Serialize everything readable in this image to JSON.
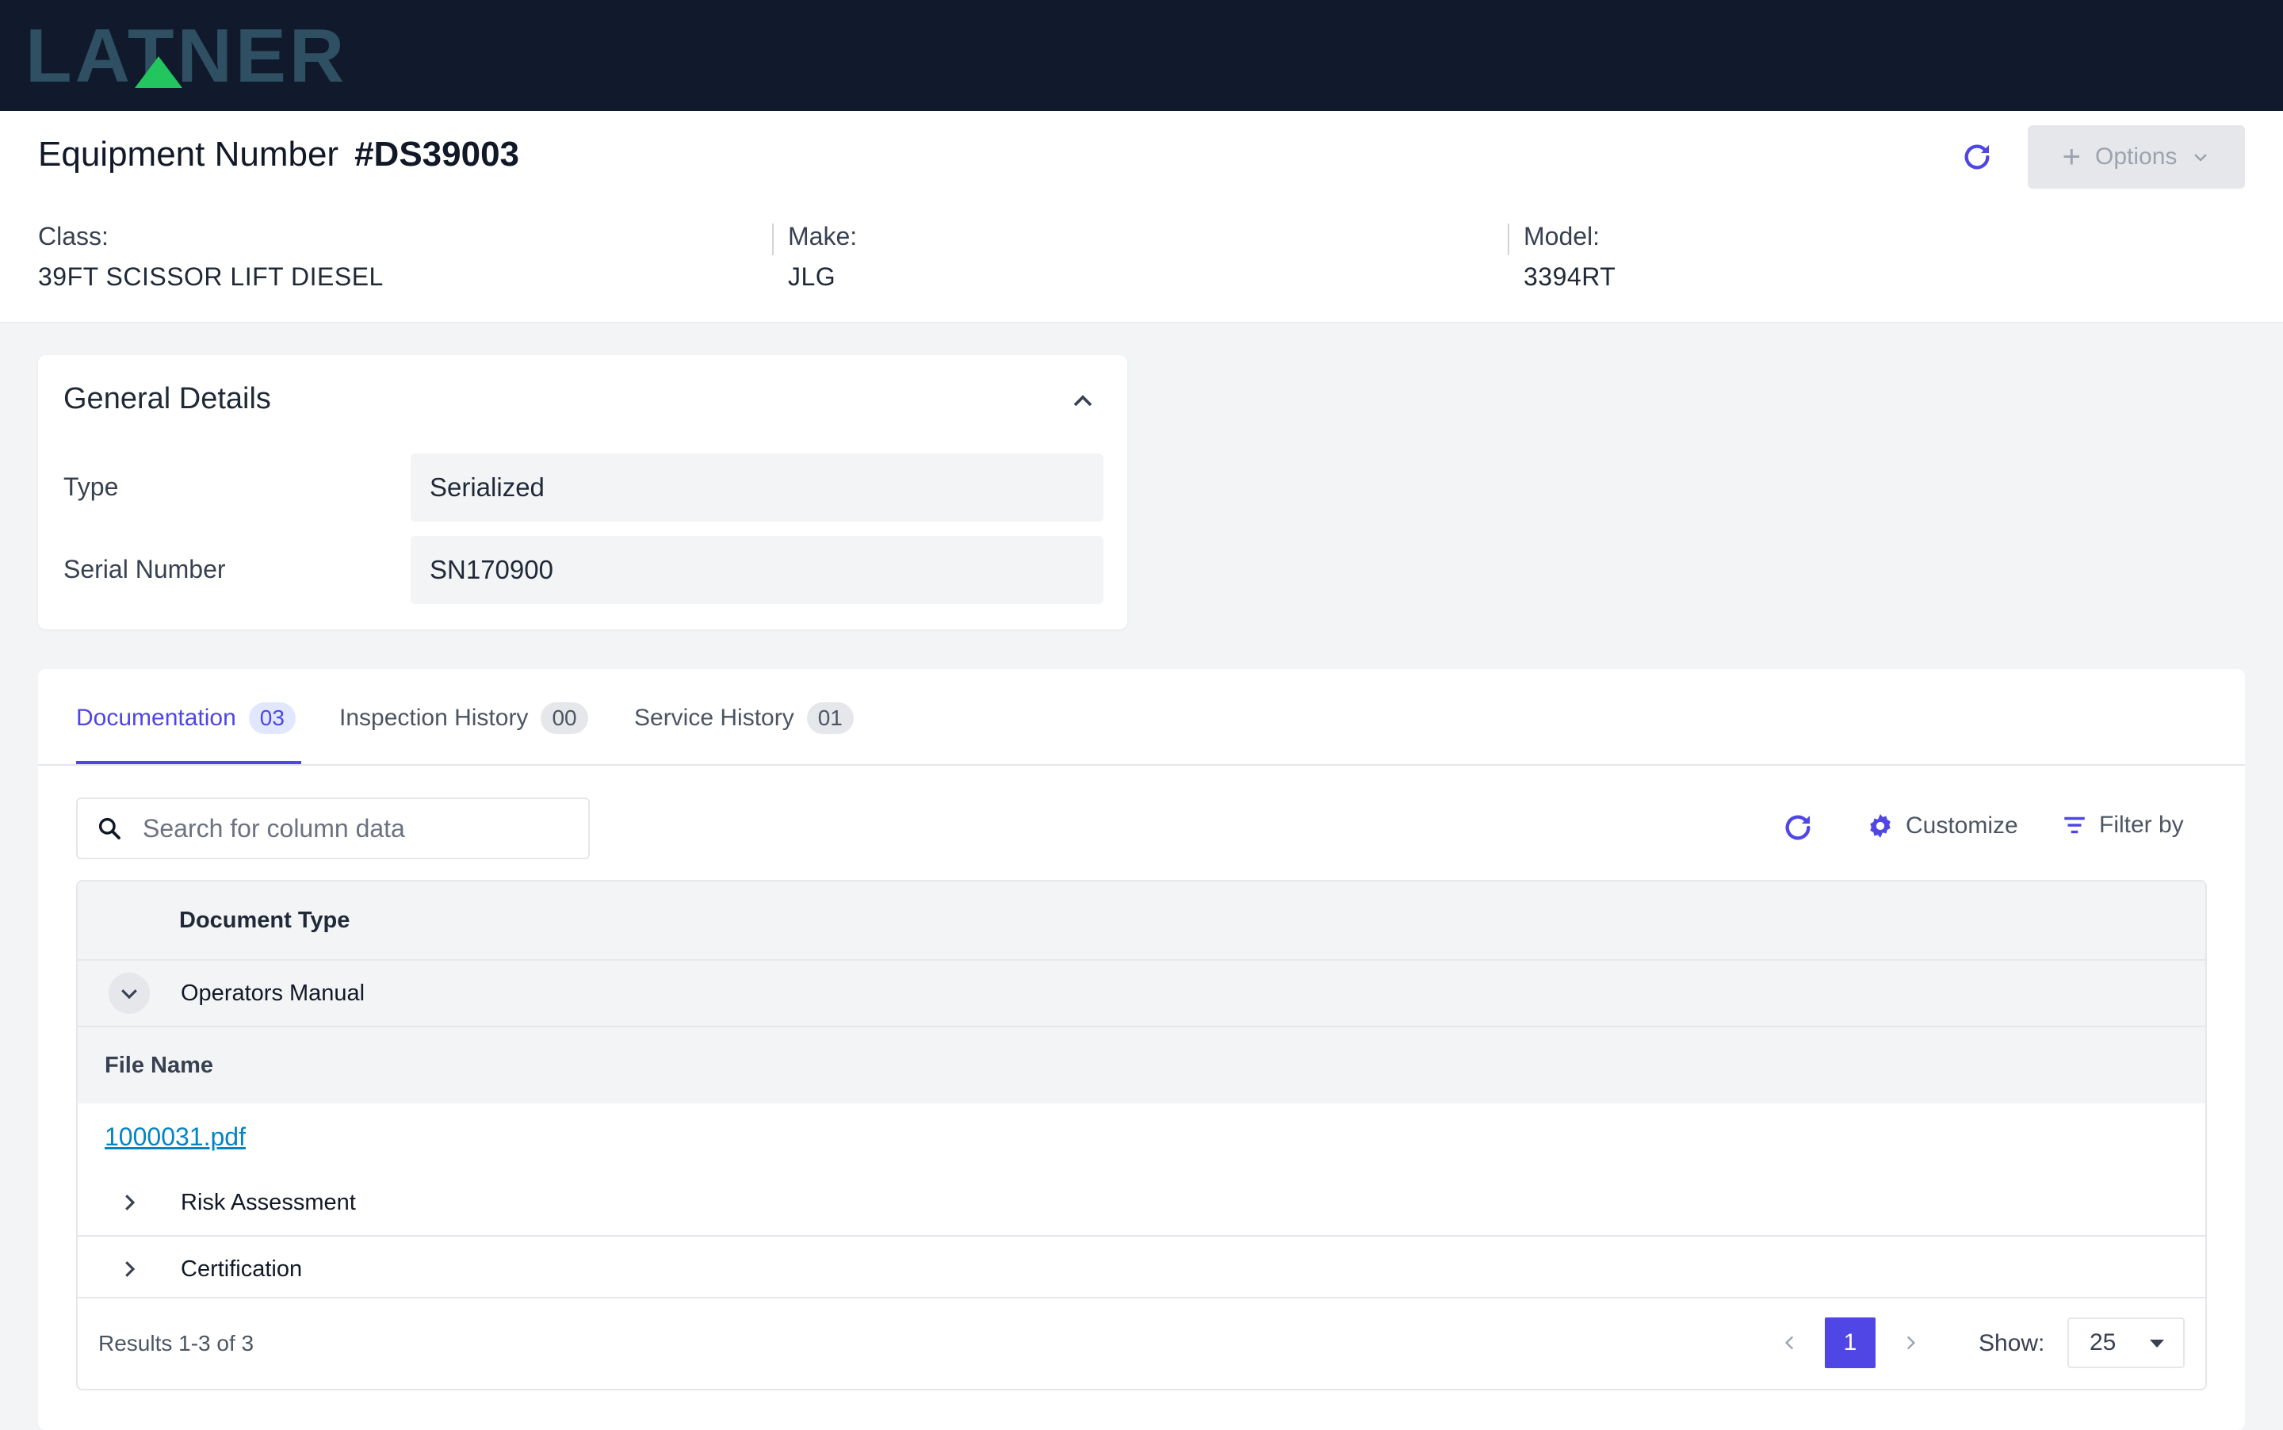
{
  "brand": {
    "logo": "LATNER",
    "logo_accent": "#22c55e"
  },
  "header": {
    "title_label": "Equipment Number",
    "equipment_number": "#DS39003",
    "options_label": "Options",
    "class_label": "Class:",
    "class_value": "39FT SCISSOR LIFT DIESEL",
    "make_label": "Make:",
    "make_value": "JLG",
    "model_label": "Model:",
    "model_value": "3394RT"
  },
  "general_details": {
    "title": "General Details",
    "type_label": "Type",
    "type_value": "Serialized",
    "serial_label": "Serial Number",
    "serial_value": "SN170900"
  },
  "tabs": [
    {
      "label": "Documentation",
      "count": "03",
      "active": true
    },
    {
      "label": "Inspection History",
      "count": "00",
      "active": false
    },
    {
      "label": "Service History",
      "count": "01",
      "active": false
    }
  ],
  "toolbar": {
    "search_placeholder": "Search for column data",
    "customize_label": "Customize",
    "filter_label": "Filter by"
  },
  "table": {
    "column_document_type": "Document Type",
    "rows": [
      {
        "label": "Operators Manual",
        "expanded": true
      },
      {
        "label": "Risk Assessment",
        "expanded": false
      },
      {
        "label": "Certification",
        "expanded": false
      }
    ],
    "sub_column_file_name": "File Name",
    "sub_file": "1000031.pdf"
  },
  "footer": {
    "results": "Results 1-3 of 3",
    "current_page": "1",
    "show_label": "Show:",
    "page_size": "25"
  },
  "colors": {
    "accent": "#4f46e5",
    "topbar": "#111a2c",
    "link": "#0284c7"
  }
}
